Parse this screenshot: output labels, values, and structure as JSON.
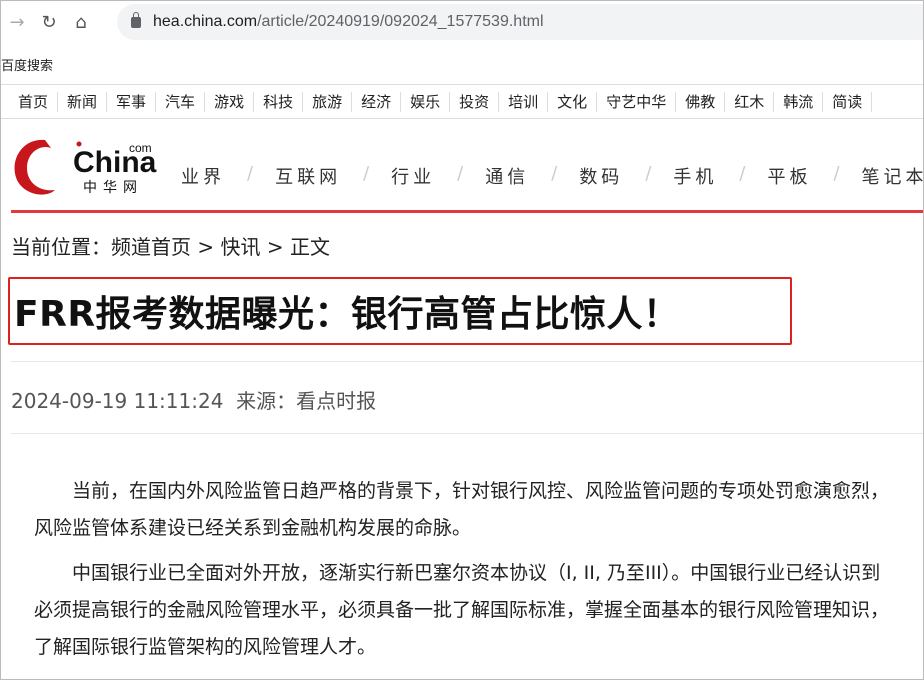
{
  "browser": {
    "url_host": "hea.china.com",
    "url_path": "/article/20240919/092024_1577539.html",
    "bookmark": "百度搜索"
  },
  "channels": [
    "首页",
    "新闻",
    "军事",
    "汽车",
    "游戏",
    "科技",
    "旅游",
    "经济",
    "娱乐",
    "投资",
    "培训",
    "文化",
    "守艺中华",
    "佛教",
    "红木",
    "韩流",
    "简读"
  ],
  "logo": {
    "text": "China",
    "com": "com",
    "cn": "中华网",
    "color": "#c8161d"
  },
  "nav": [
    "业界",
    "互联网",
    "行业",
    "通信",
    "数码",
    "手机",
    "平板",
    "笔记本"
  ],
  "breadcrumb": {
    "prefix": "当前位置：",
    "items": [
      "频道首页",
      "快讯",
      "正文"
    ],
    "sep": " > "
  },
  "article": {
    "title": "FRR报考数据曝光：银行高管占比惊人！",
    "date": "2024-09-19 11:11:24",
    "source": "来源：看点时报",
    "paragraphs": [
      "当前，在国内外风险监管日趋严格的背景下，针对银行风控、风险监管问题的专项处罚愈演愈烈，风险监管体系建设已经关系到金融机构发展的命脉。",
      "中国银行业已全面对外开放，逐渐实行新巴塞尔资本协议（I, II, 乃至III）。中国银行业已经认识到必须提高银行的金融风险管理水平，必须具备一批了解国际标准，掌握全面基本的银行风险管理知识，了解国际银行监管架构的风险管理人才。"
    ]
  },
  "colors": {
    "accent": "#e02020"
  }
}
